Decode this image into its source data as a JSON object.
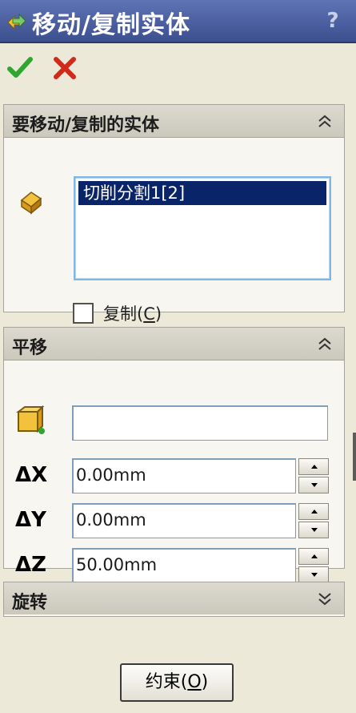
{
  "titlebar": {
    "title": "移动/复制实体",
    "help": "?"
  },
  "actions": {
    "ok": "confirm",
    "cancel": "cancel"
  },
  "bodies_panel": {
    "title": "要移动/复制的实体",
    "selection_items": [
      "切削分割1[2]"
    ],
    "copy_checkbox": {
      "label": "复制(",
      "mnemonic": "C",
      "suffix": ")",
      "checked": false
    }
  },
  "translate_panel": {
    "title": "平移",
    "reference_value": "",
    "delta_x": {
      "label": "ΔX",
      "value": "0.00mm"
    },
    "delta_y": {
      "label": "ΔY",
      "value": "0.00mm"
    },
    "delta_z": {
      "label": "ΔZ",
      "value": "50.00mm"
    }
  },
  "rotate_panel": {
    "title": "旋转",
    "collapsed": true
  },
  "constraint_button": {
    "label": "约束(",
    "mnemonic": "O",
    "suffix": ")"
  },
  "colors": {
    "title_bar": "#3c4f8f",
    "selection": "#0a246a",
    "ok": "#2fa62f",
    "cancel": "#d12a1a"
  }
}
